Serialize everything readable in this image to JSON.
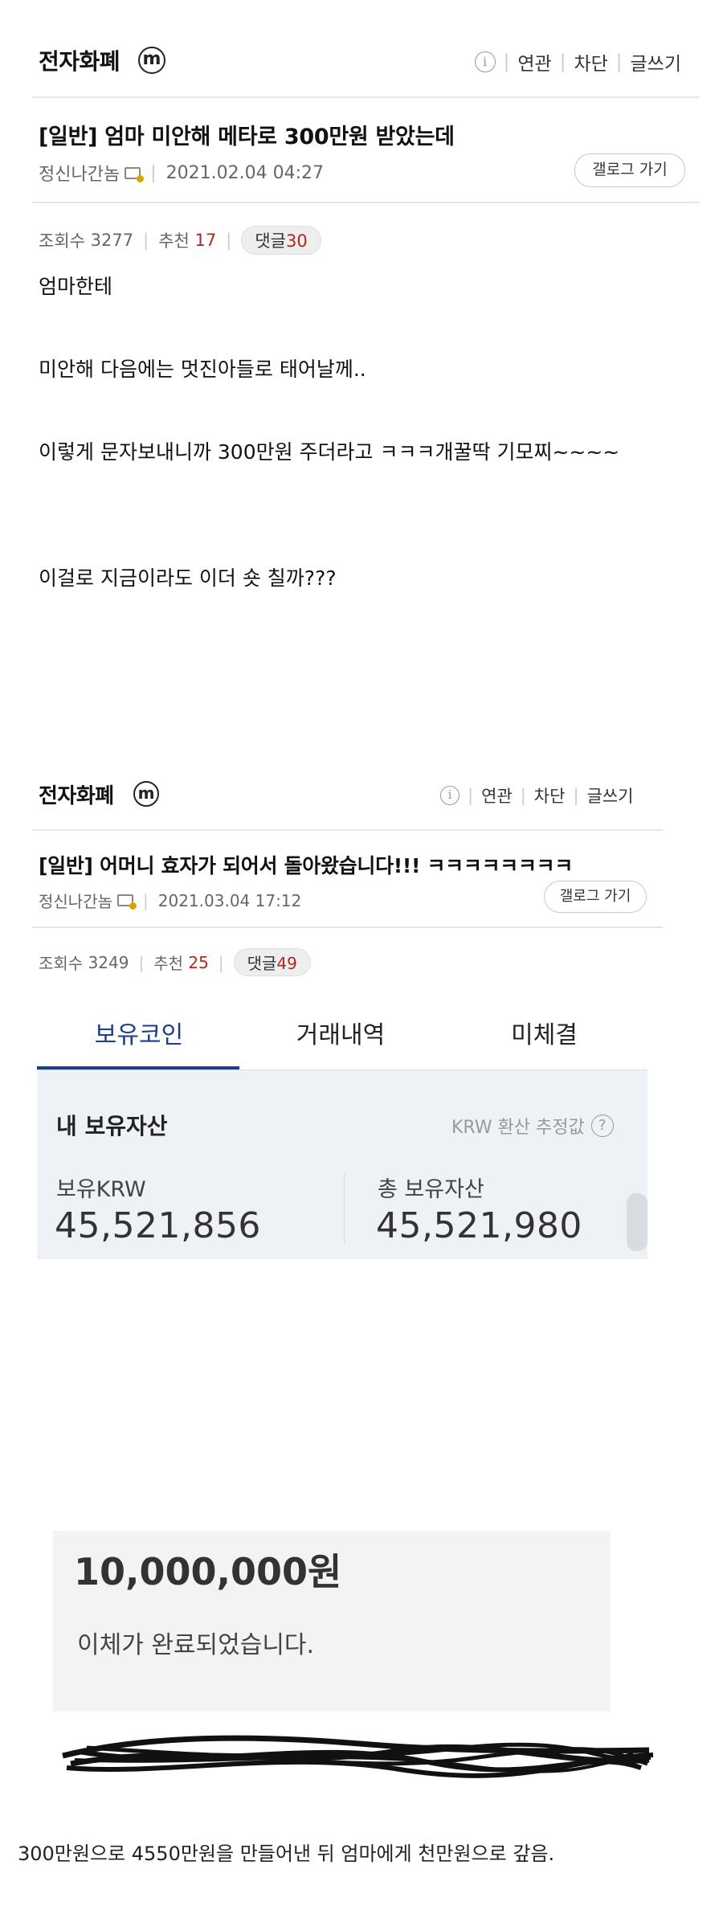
{
  "post1": {
    "gallery_title": "전자화폐",
    "gallery_badge": "m",
    "info_icon": "info-icon",
    "links": [
      "연관",
      "차단",
      "글쓰기"
    ],
    "title": "[일반] 엄마 미안해 메타로 300만원 받았는데",
    "nickname": "정신나간놈",
    "date": "2021.02.04 04:27",
    "gallery_button": "갤로그 가기",
    "views_label": "조회수",
    "views": "3277",
    "recommend_label": "추천",
    "recommend": "17",
    "reply_label": "댓글",
    "replies": "30",
    "body": [
      "엄마한테",
      "미안해 다음에는 멋진아들로 태어날께..",
      "이렇게 문자보내니까 300만원 주더라고 ㅋㅋㅋ개꿀딱 기모찌~~~~",
      "이걸로 지금이라도 이더 숏 칠까???"
    ]
  },
  "post2": {
    "gallery_title": "전자화폐",
    "gallery_badge": "m",
    "links": [
      "연관",
      "차단",
      "글쓰기"
    ],
    "title": "[일반] 어머니 효자가 되어서 돌아왔습니다!!! ㅋㅋㅋㅋㅋㅋㅋㅋ",
    "nickname": "정신나간놈",
    "date": "2021.03.04 17:12",
    "gallery_button": "갤로그 가기",
    "views_label": "조회수",
    "views": "3249",
    "recommend_label": "추천",
    "recommend": "25",
    "reply_label": "댓글",
    "replies": "49"
  },
  "exchange": {
    "tabs": [
      "보유코인",
      "거래내역",
      "미체결"
    ],
    "active_tab": 0,
    "section_title": "내 보유자산",
    "krw_note": "KRW 환산 추정값",
    "krw_label": "보유KRW",
    "krw_value": "45,521,856",
    "total_label": "총 보유자산",
    "total_value": "45,521,980",
    "accent_color": "#1a3e8c"
  },
  "transfer": {
    "amount": "10,000,000원",
    "status": "이체가 완료되었습니다."
  },
  "caption": "300만원으로 4550만원을 만들어낸 뒤 엄마에게 천만원으로 갚음."
}
